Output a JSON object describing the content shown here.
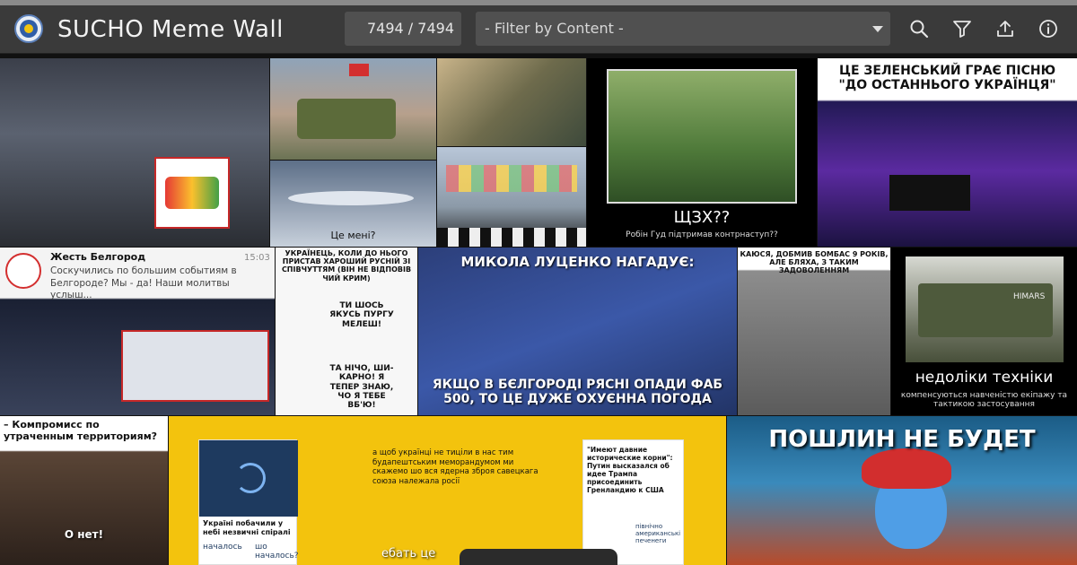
{
  "header": {
    "title": "SUCHO Meme Wall",
    "counter": "7494 / 7494",
    "filter_placeholder": "- Filter by Content -",
    "icons": [
      "search-icon",
      "filter-icon",
      "upload-icon",
      "info-icon"
    ]
  },
  "tiles": {
    "t3_caption": "Це мені?",
    "t6_caption": "ЩЗХ??",
    "t6_sub": "Робін Гуд підтримав контрнаступ??",
    "t7_caption": "ЦЕ ЗЕЛЕНСЬКИЙ ГРАЄ ПІСНЮ \"ДО ОСТАННЬОГО УКРАЇНЦЯ\"",
    "t8_channel": "Жесть Белгород",
    "t8_time": "15:03",
    "t8_text": "Соскучились по большим событиям в Белгороде? Мы - да! Наши молитвы услыш...",
    "t9_top": "УКРАЇНЕЦЬ, КОЛИ ДО НЬОГО ПРИСТАВ ХАРОШИЙ РУСНІЙ ЗІ СПІВЧУТТЯМ (ВІН НЕ ВІДПОВІВ ЧИЙ КРИМ)",
    "t9_bubble1": "ТИ ШОСЬ ЯКУСЬ ПУРГУ МЕЛЕШ!",
    "t9_bubble2": "ТА НІЧО, ШИ-КАРНО! Я ТЕПЕР ЗНАЮ, ЧО Я ТЕБЕ ВБ'Ю!",
    "t10_top": "МИКОЛА ЛУЦЕНКО НАГАДУЄ:",
    "t10_bottom": "ЯКЩО В БЄЛГОРОДІ РЯСНІ ОПАДИ ФАБ 500, ТО ЦЕ ДУЖЕ ОХУЄННА ПОГОДА",
    "t11_caption": "КАЮСЯ, ДОБМИВ БОМБАС 9 РОКІВ, АЛЕ БЛЯХА, З ТАКИМ ЗАДОВОЛЕННЯМ",
    "t12_caption": "недоліки техніки",
    "t12_sub": "компенсуються навченістю екіпажу та тактикою застосування",
    "t12_vehicle": "HIMARS",
    "t13_caption": "– Компромисс по утраченным территориям?",
    "t13_sub": "О нет!",
    "t14_card1": "Україні побачили у небі незвичні спіралі",
    "t14_card1_b": "началось",
    "t14_card1_c": "шо началось?",
    "t14_card2": "а щоб українці не тиціли в нас тим будапештським меморандумом ми скажемо шо вся ядерна зброя савецкага союза належала росії",
    "t14_card2_b": "ебать це",
    "t14_card3": "\"Имеют давние исторические корни\": Путин высказался об идее Трампа присоединить Гренландию к США",
    "t14_card3_b": "північно американські печенеги",
    "t15_caption": "ПОШЛИН НЕ БУДЕТ"
  }
}
